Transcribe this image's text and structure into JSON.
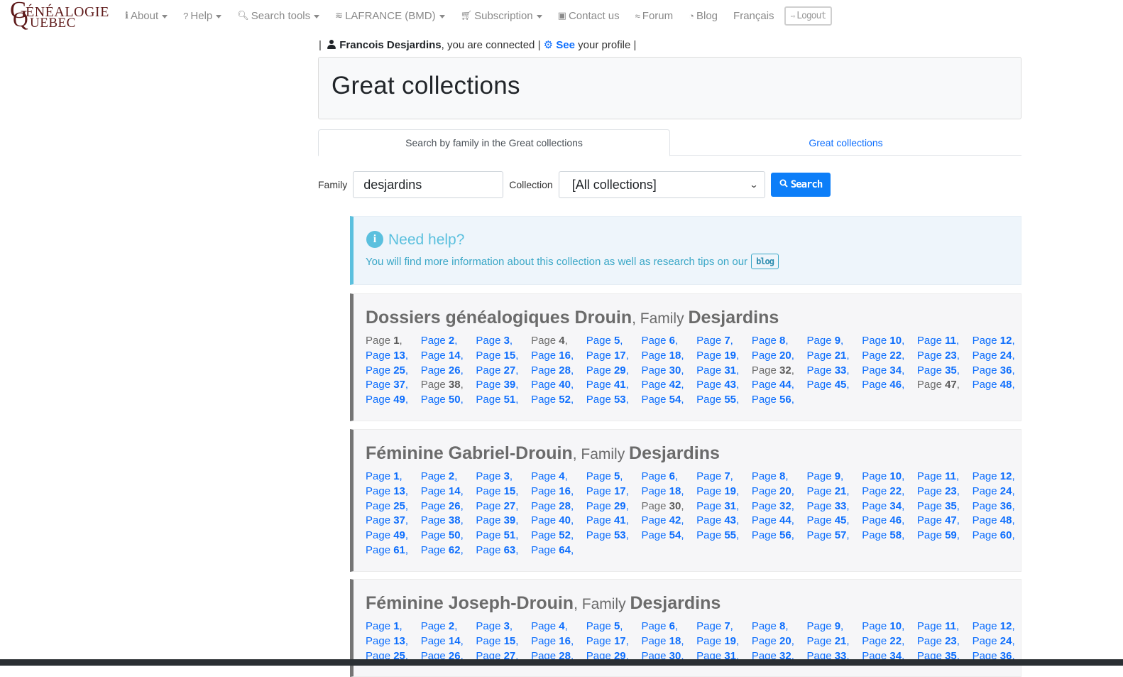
{
  "navbar": {
    "logo": {
      "line1": "ÉNÉALOGIE",
      "line2": "UEBEC",
      "initial1": "G",
      "initial2": "Q"
    },
    "items": [
      {
        "label": "About",
        "icon": "info-icon",
        "glyph": "ℹ",
        "dropdown": true
      },
      {
        "label": "Help",
        "icon": "question-icon",
        "glyph": "?",
        "dropdown": true
      },
      {
        "label": "Search tools",
        "icon": "search-icon",
        "glyph": "🔍︎",
        "dropdown": true
      },
      {
        "label": "LAFRANCE (BMD)",
        "icon": "database-icon",
        "glyph": "≋",
        "dropdown": true
      },
      {
        "label": "Subscription",
        "icon": "cart-icon",
        "glyph": "🛒︎",
        "dropdown": true
      },
      {
        "label": "Contact us",
        "icon": "contact-book-icon",
        "glyph": "▣",
        "dropdown": false
      },
      {
        "label": "Forum",
        "icon": "forum-icon",
        "glyph": "≈",
        "dropdown": false
      },
      {
        "label": "Blog",
        "icon": "blog-icon",
        "glyph": "◔",
        "dropdown": false
      },
      {
        "label": "Français",
        "icon": "",
        "glyph": "",
        "dropdown": false
      }
    ],
    "logout_label": "Logout",
    "logout_glyph": "⇨"
  },
  "user": {
    "sep": "|",
    "name": "Francois Desjardins",
    "connected_text": ", you are connected",
    "see_label": "See",
    "profile_text": " your profile",
    "gear_glyph": "⚙"
  },
  "page_title": "Great collections",
  "tabs": [
    {
      "label": "Search by family in the Great collections",
      "active": true
    },
    {
      "label": "Great collections",
      "active": false
    }
  ],
  "search": {
    "family_label": "Family",
    "family_value": "desjardins",
    "collection_label": "Collection",
    "collection_selected": "[All collections]",
    "button_label": "Search"
  },
  "help": {
    "title": "Need help?",
    "text": "You will find more information about this collection as well as research tips on our",
    "blog_label": "blog"
  },
  "collections": [
    {
      "name": "Dossiers généalogiques Drouin",
      "family_prefix": ", Family ",
      "family": "Desjardins",
      "page_count": 56,
      "unavailable_pages": [
        1,
        4,
        32,
        38,
        47
      ]
    },
    {
      "name": "Féminine Gabriel-Drouin",
      "family_prefix": ", Family ",
      "family": "Desjardins",
      "page_count": 64,
      "unavailable_pages": [
        30
      ]
    },
    {
      "name": "Féminine Joseph-Drouin",
      "family_prefix": ", Family ",
      "family": "Desjardins",
      "page_count": 36,
      "unavailable_pages": []
    }
  ],
  "page_label_prefix": "Page ",
  "page_label_suffix": ","
}
